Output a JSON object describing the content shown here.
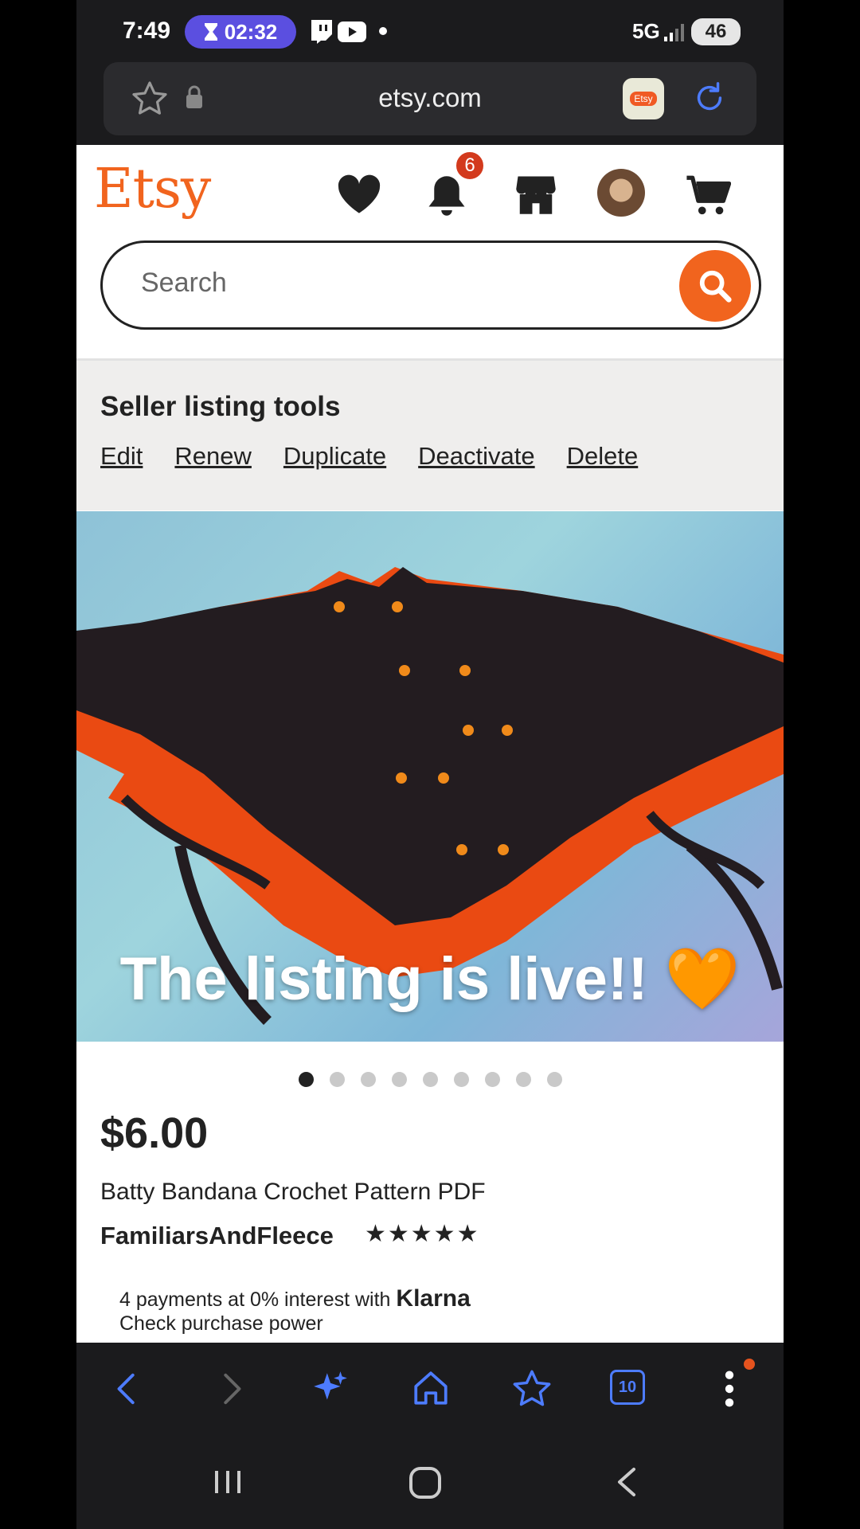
{
  "status_bar": {
    "time": "7:49",
    "timer": "02:32",
    "network": "5G",
    "battery": "46"
  },
  "browser": {
    "url": "etsy.com",
    "favicon_label": "Etsy"
  },
  "header": {
    "logo": "Etsy",
    "notification_count": "6"
  },
  "search": {
    "placeholder": "Search"
  },
  "seller_tools": {
    "title": "Seller listing tools",
    "actions": [
      "Edit",
      "Renew",
      "Duplicate",
      "Deactivate",
      "Delete"
    ]
  },
  "listing": {
    "image_caption": "The listing is live!! 🧡",
    "image_count": 9,
    "active_image": 1,
    "price": "$6.00",
    "title": "Batty Bandana Crochet Pattern PDF",
    "shop_name": "FamiliarsAndFleece",
    "rating": "★★★★★",
    "klarna_text": "4 payments at 0% interest with",
    "klarna_brand": "Klarna",
    "klarna_link": "Check purchase power"
  },
  "toolbar": {
    "tab_count": "10"
  },
  "colors": {
    "etsy_orange": "#f1641e",
    "badge_red": "#d33a1d",
    "browser_accent": "#4d7cff"
  }
}
